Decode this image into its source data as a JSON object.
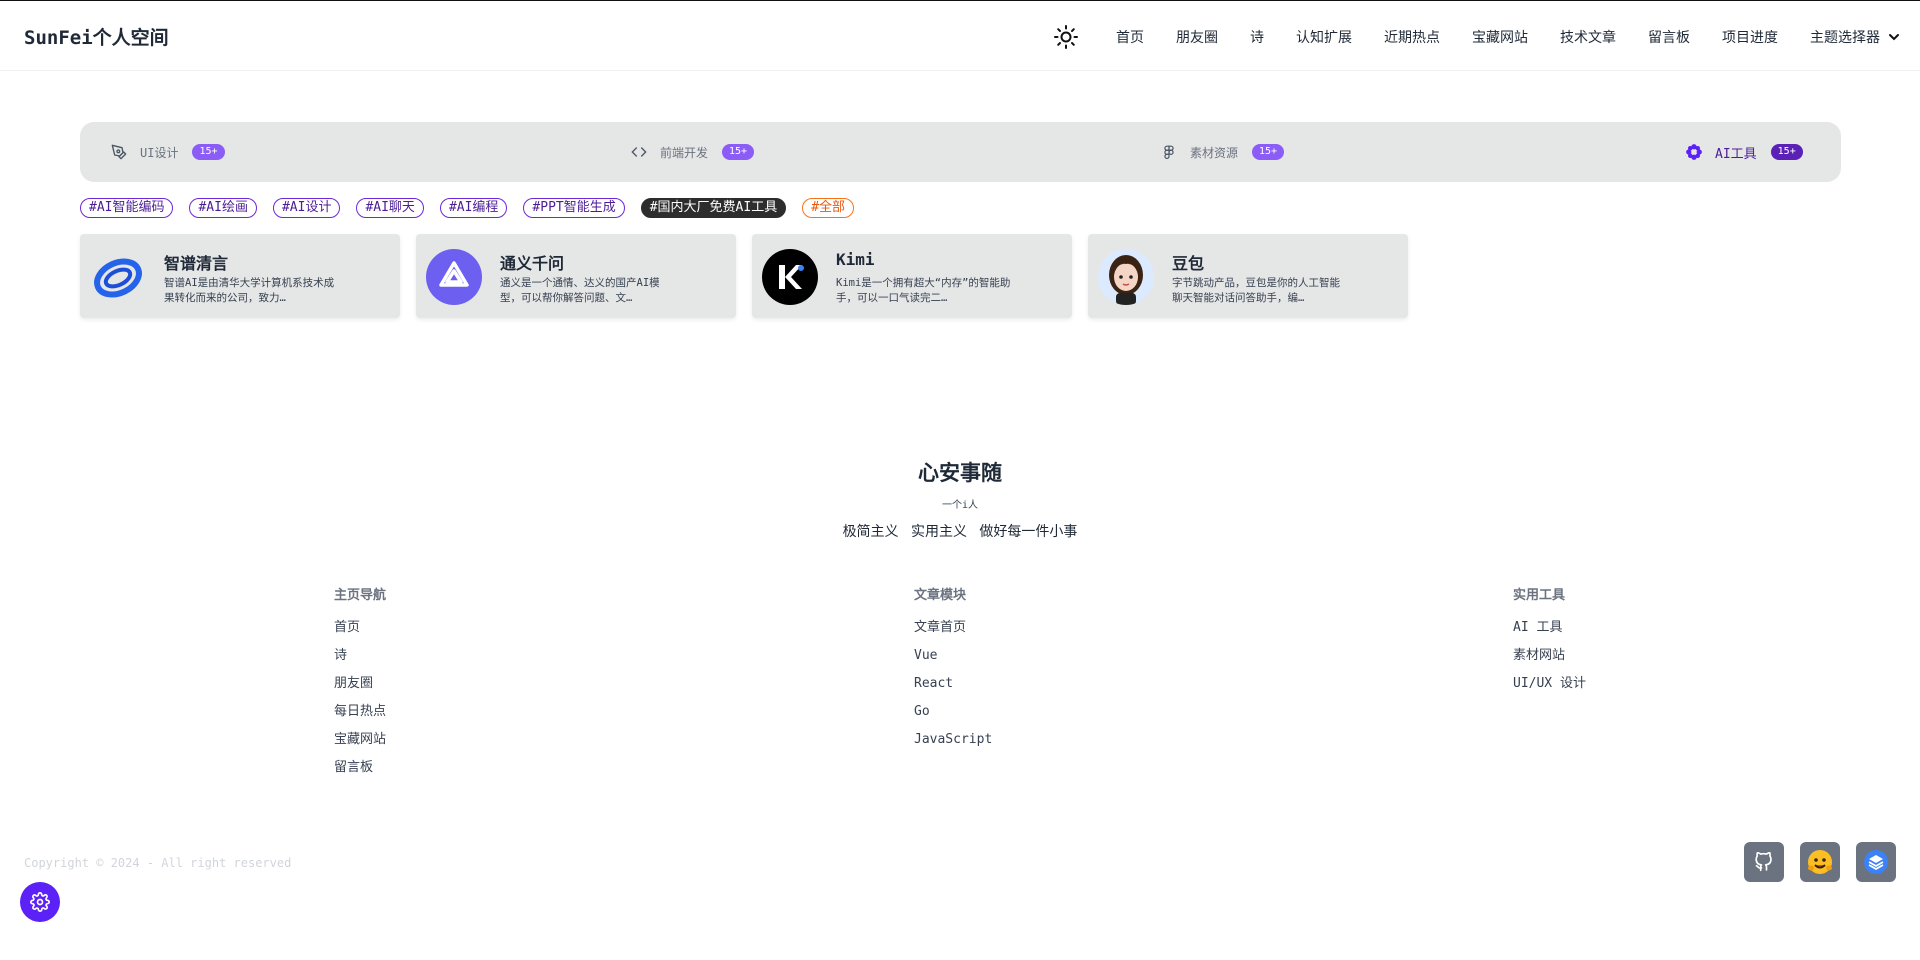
{
  "header": {
    "brand": "SunFei个人空间",
    "theme_toggle_icon": "sun-icon",
    "nav": [
      "首页",
      "朋友圈",
      "诗",
      "认知扩展",
      "近期热点",
      "宝藏网站",
      "技术文章",
      "留言板",
      "项目进度"
    ],
    "theme_selector": "主题选择器"
  },
  "categories": [
    {
      "label": "UI设计",
      "badge": "15+",
      "icon": "pen-tool-icon"
    },
    {
      "label": "前端开发",
      "badge": "15+",
      "icon": "code-icon"
    },
    {
      "label": "素材资源",
      "badge": "15+",
      "icon": "figma-icon"
    },
    {
      "label": "AI工具",
      "badge": "15+",
      "icon": "flower-icon",
      "active": true
    }
  ],
  "tags": [
    "#AI智能编码",
    "#AI绘画",
    "#AI设计",
    "#AI聊天",
    "#AI编程",
    "#PPT智能生成",
    "#国内大厂免费AI工具",
    "#全部"
  ],
  "cards": [
    {
      "title": "智谱清言",
      "desc": "智谱AI是由清华大学计算机系技术成果转化而来的公司，致力…",
      "icon": "zhipu-logo-icon"
    },
    {
      "title": "通义千问",
      "desc": "通义是一个通情、达义的国产AI模型，可以帮你解答问题、文…",
      "icon": "tongyi-logo-icon"
    },
    {
      "title": "Kimi",
      "desc": "Kimi是一个拥有超大“内存”的智能助手，可以一口气读完二…",
      "icon": "kimi-logo-icon"
    },
    {
      "title": "豆包",
      "desc": "字节跳动产品，豆包是你的人工智能聊天智能对话问答助手，编…",
      "icon": "doubao-avatar-icon"
    }
  ],
  "motto": {
    "title": "心安事随",
    "subtitle": "一个i人",
    "line": "极简主义 实用主义 做好每一件小事"
  },
  "footer": {
    "columns": [
      {
        "title": "主页导航",
        "links": [
          "首页",
          "诗",
          "朋友圈",
          "每日热点",
          "宝藏网站",
          "留言板"
        ]
      },
      {
        "title": "文章模块",
        "links": [
          "文章首页",
          "Vue",
          "React",
          "Go",
          "JavaScript"
        ]
      },
      {
        "title": "实用工具",
        "links": [
          "AI 工具",
          "素材网站",
          "UI/UX 设计"
        ]
      }
    ],
    "copyright": "Copyright © 2024 - All right reserved"
  },
  "social": [
    "github-icon",
    "huggingface-icon",
    "layers-icon"
  ],
  "settings_icon": "gear-icon",
  "colors": {
    "accent": "#5b21f6",
    "badge": "#8b5cf6",
    "tag_orange": "#f97316"
  }
}
